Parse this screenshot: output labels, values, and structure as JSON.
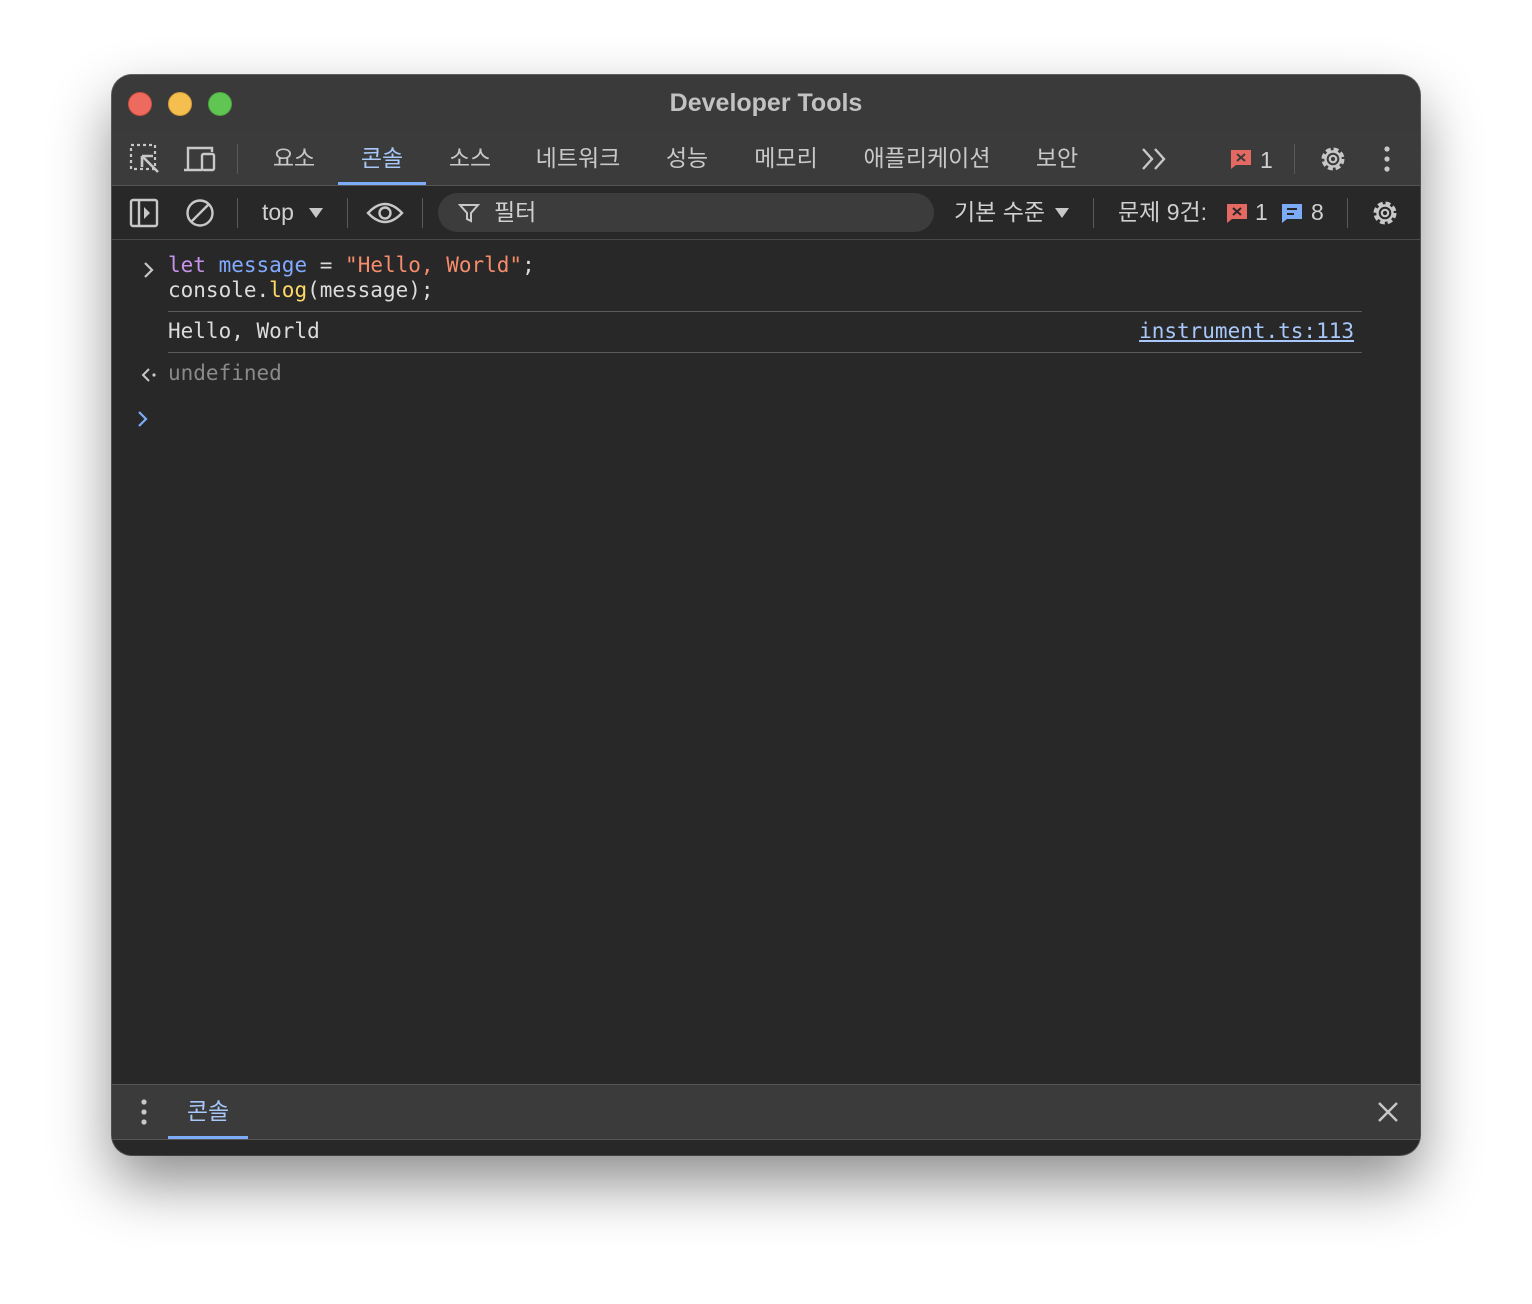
{
  "window": {
    "title": "Developer Tools"
  },
  "tabs": [
    {
      "label": "요소"
    },
    {
      "label": "콘솔",
      "active": true
    },
    {
      "label": "소스"
    },
    {
      "label": "네트워크"
    },
    {
      "label": "성능"
    },
    {
      "label": "메모리"
    },
    {
      "label": "애플리케이션"
    },
    {
      "label": "보안"
    }
  ],
  "tabbar": {
    "error_count": "1"
  },
  "toolbar": {
    "context": "top",
    "filter_placeholder": "필터",
    "level": "기본 수준",
    "issues_label": "문제 9건:",
    "issues_errors": "1",
    "issues_messages": "8"
  },
  "console": {
    "input_line1": {
      "kw": "let",
      "var": "message",
      "op": " = ",
      "str": "\"Hello, World\"",
      "end": ";"
    },
    "input_line2": {
      "obj": "console.",
      "fn": "log",
      "args": "(message);"
    },
    "log_output": "Hello, World",
    "log_source": "instrument.ts:113",
    "return_value": "undefined"
  },
  "drawer": {
    "tab_label": "콘솔"
  },
  "colors": {
    "accent": "#7cacf8",
    "error": "#e46962",
    "info": "#7cacf8",
    "keyword": "#c792ea",
    "string": "#f78c6c",
    "function": "#ffd866"
  }
}
